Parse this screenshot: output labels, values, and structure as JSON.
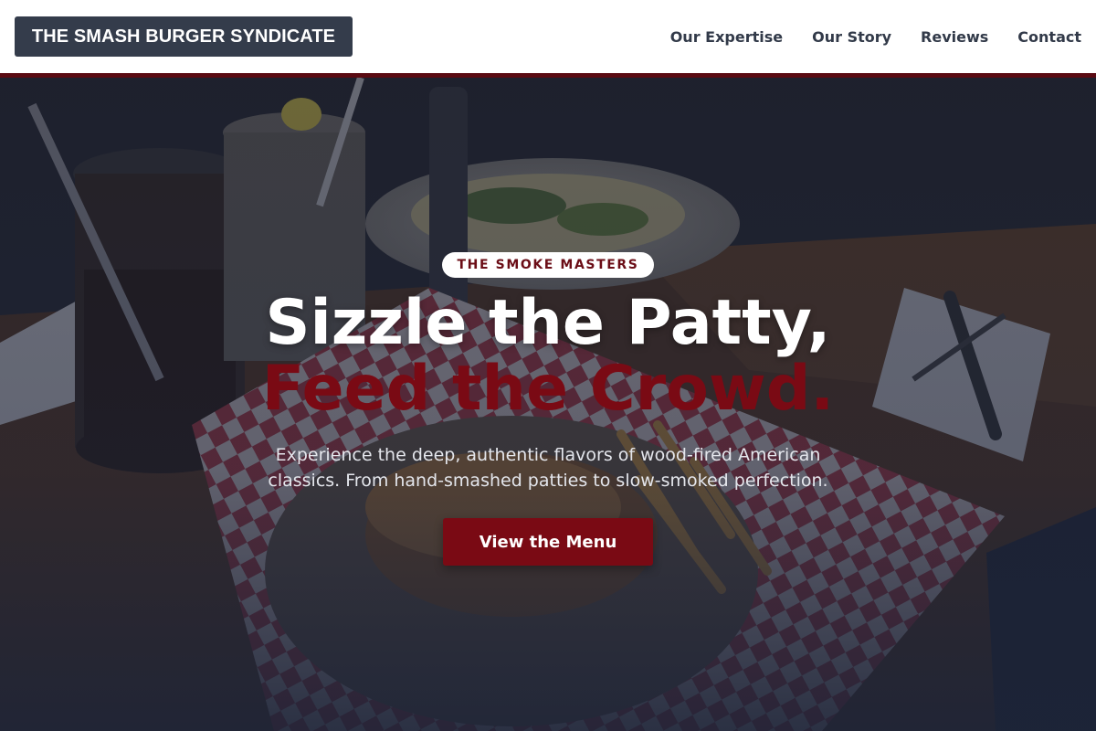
{
  "brand": {
    "name": "THE SMASH BURGER SYNDICATE"
  },
  "nav": {
    "items": [
      {
        "label": "Our Expertise"
      },
      {
        "label": "Our Story"
      },
      {
        "label": "Reviews"
      },
      {
        "label": "Contact"
      }
    ]
  },
  "hero": {
    "badge": "THE SMOKE MASTERS",
    "headline_line1": "Sizzle the Patty,",
    "headline_line2": "Feed the Crowd.",
    "subtitle": "Experience the deep, authentic flavors of wood-fired American classics. From hand-smashed patties to slow-smoked perfection.",
    "cta_label": "View the Menu",
    "background_image": "burger-restaurant-table-photo"
  },
  "colors": {
    "accent": "#7a0a14",
    "header_bg": "#ffffff",
    "logo_bg": "#343c4b",
    "nav_text": "#323a49",
    "hero_overlay": "#1c2333"
  }
}
